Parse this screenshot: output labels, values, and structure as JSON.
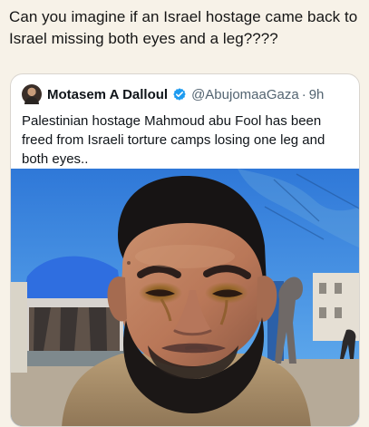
{
  "post": {
    "text": "Can you imagine if an Israel hostage came back to Israel missing both eyes and a leg????"
  },
  "quoted_post": {
    "author_name": "Motasem A Dalloul",
    "verified": true,
    "handle": "@AbujomaaGaza",
    "separator": "·",
    "timestamp": "9h",
    "text": "Palestinian hostage Mahmoud abu Fool has been freed from Israeli torture camps losing one leg and both eyes..",
    "media": {
      "type": "photo",
      "subject": "man-close-up-portrait"
    }
  },
  "icons": {
    "avatar": "avatar-photo",
    "verified": "verified-badge-icon"
  },
  "colors": {
    "background": "#f7f2e8",
    "card": "#ffffff",
    "muted_text": "#536471",
    "verified_blue": "#1d9bf0"
  }
}
